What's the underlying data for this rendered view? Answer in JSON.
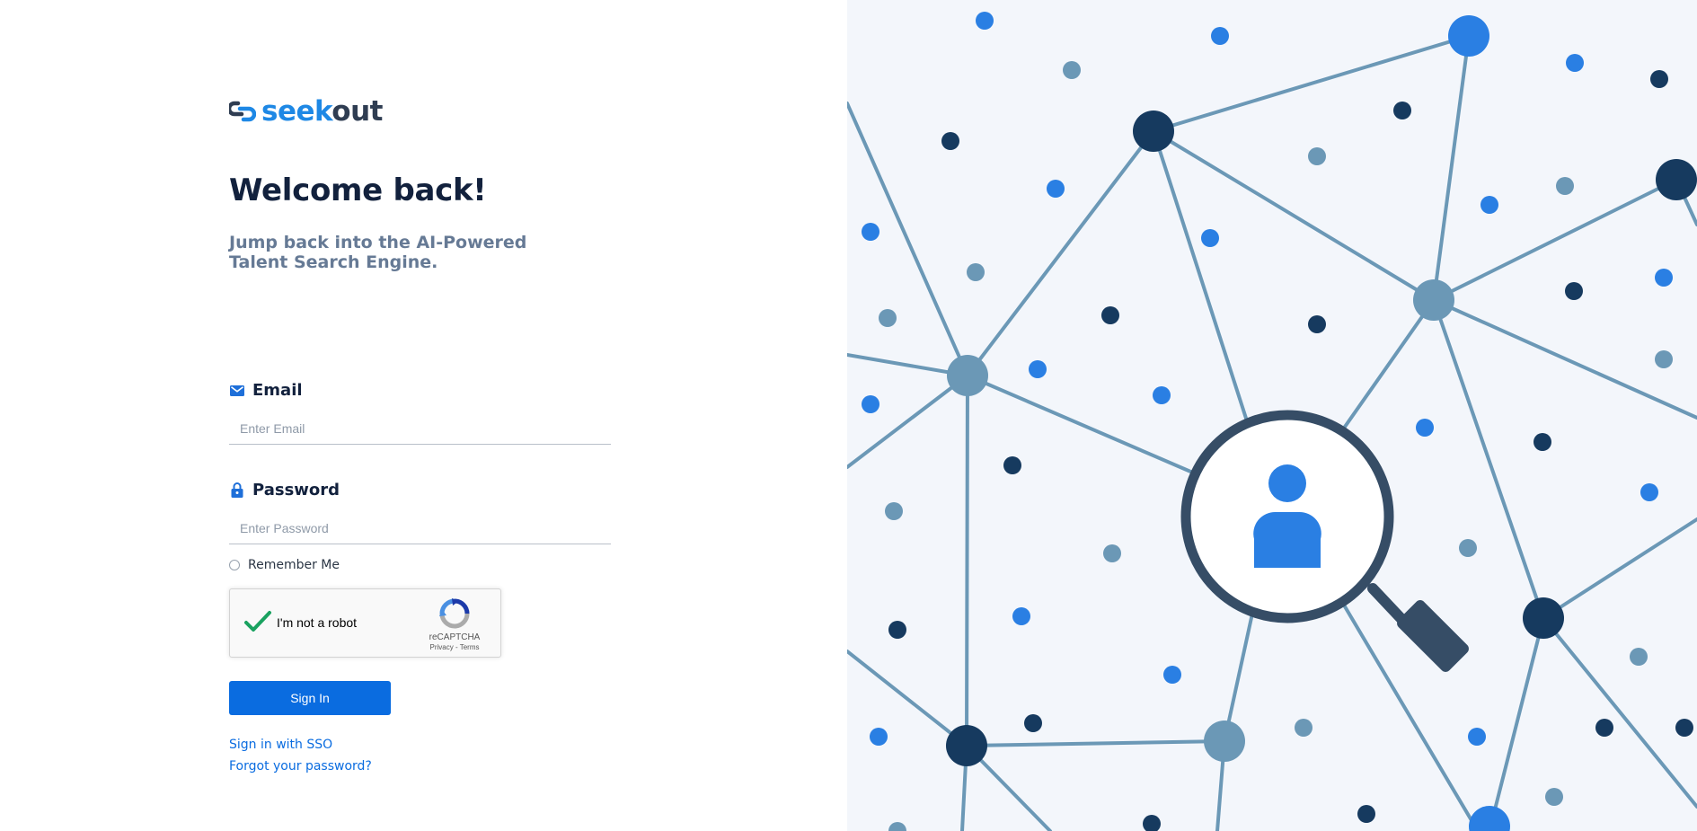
{
  "brand": {
    "seek": "seek",
    "out": "out",
    "primary_color": "#1e88e5",
    "dark_color": "#2f3d52"
  },
  "welcome": {
    "title": "Welcome back!",
    "subtitle": "Jump back into the AI-Powered Talent Search Engine."
  },
  "form": {
    "email_label": "Email",
    "email_placeholder": "Enter Email",
    "email_value": "",
    "email_icon": "envelope-icon",
    "password_label": "Password",
    "password_placeholder": "Enter Password",
    "password_value": "",
    "password_icon": "lock-icon",
    "remember_label": "Remember Me",
    "remember_checked": false,
    "captcha": {
      "label": "I'm not a robot",
      "checked": true,
      "brand": "reCAPTCHA",
      "links": "Privacy - Terms"
    },
    "submit_label": "Sign In",
    "submit_color": "#0a6ce0",
    "sso_link": "Sign in with SSO",
    "forgot_link": "Forgot your password?"
  },
  "illustration": {
    "icon": "magnifier-person-icon",
    "colors": {
      "background": "#f3f6fb",
      "line": "#6b98b6",
      "node_dark": "#163a5f",
      "node_blue": "#2a7fe3",
      "node_grey": "#6b98b6"
    }
  }
}
